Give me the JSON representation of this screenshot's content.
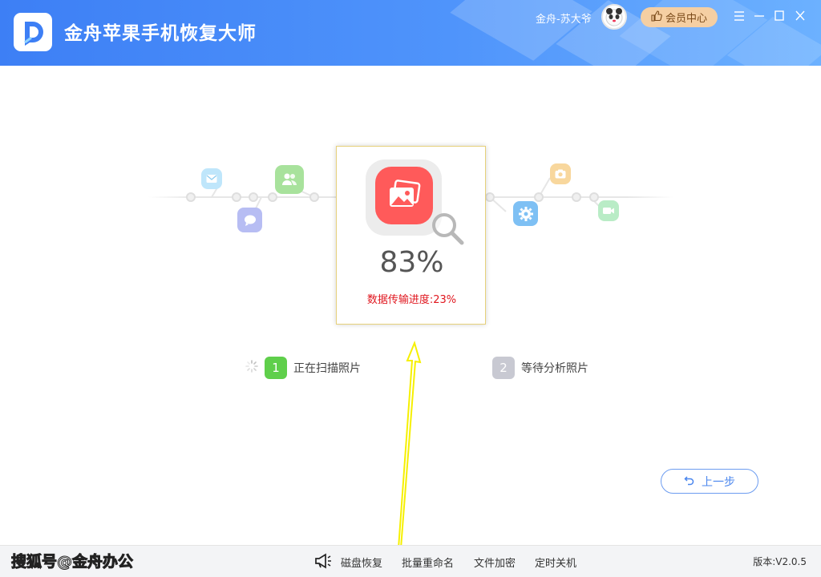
{
  "header": {
    "title": "金舟苹果手机恢复大师",
    "user_name": "金舟-苏大爷",
    "member_label": "会员中心",
    "brand_color": "#4a8cf7"
  },
  "window_controls": [
    "menu-icon",
    "minimize-icon",
    "maximize-icon",
    "close-icon"
  ],
  "timeline_icons": [
    "mail-icon",
    "contacts-icon",
    "message-icon",
    "settings-icon",
    "camera-icon",
    "video-icon"
  ],
  "progress": {
    "percent_text": "83%",
    "percent_value": 83,
    "transfer_label": "数据传输进度:23%",
    "transfer_value": 23,
    "icon": "photos-icon"
  },
  "steps": [
    {
      "number": "1",
      "label": "正在扫描照片",
      "status": "active",
      "color": "#5fcf4b"
    },
    {
      "number": "2",
      "label": "等待分析照片",
      "status": "pending",
      "color": "#c8c9d2"
    }
  ],
  "prev_button": {
    "label": "上一步"
  },
  "footer": {
    "watermark": "搜狐号@金舟办公",
    "items": [
      "磁盘恢复",
      "批量重命名",
      "文件加密",
      "定时关机"
    ],
    "version": "版本:V2.0.5"
  }
}
